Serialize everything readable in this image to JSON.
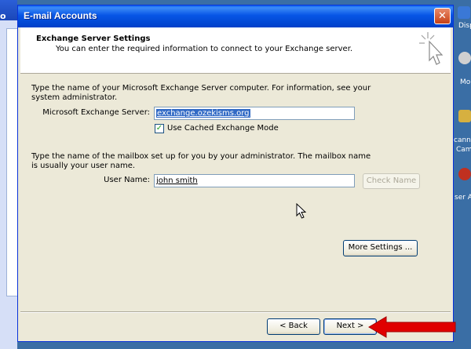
{
  "background": {
    "left_window_label": "o",
    "right_icons": [
      {
        "label": "Disp",
        "icon": "display-icon",
        "color": "#3a78d6"
      },
      {
        "label": "Mo",
        "icon": "mouse-icon",
        "color": "#d0d0d0"
      },
      {
        "label": "canne",
        "icon": "scanner-icon",
        "color": "#d6b040"
      },
      {
        "label": "Cam",
        "icon": "camera-icon",
        "color": "#d6b040"
      },
      {
        "label": "ser A",
        "icon": "user-accounts-icon",
        "color": "#c03020"
      }
    ]
  },
  "dialog": {
    "title": "E-mail Accounts",
    "close_glyph": "✕",
    "header": {
      "title": "Exchange Server Settings",
      "subtitle": "You can enter the required information to connect to your Exchange server."
    },
    "server_section": {
      "instruction_line1": "Type the name of your Microsoft Exchange Server computer. For information, see your",
      "instruction_line2": "system administrator.",
      "server_label": "Microsoft Exchange Server:",
      "server_value": "exchange.ozekisms.org",
      "cached_mode_label": "Use Cached Exchange Mode",
      "cached_mode_checked": true
    },
    "mailbox_section": {
      "instruction_line1": "Type the name of the mailbox set up for you by your administrator. The mailbox name",
      "instruction_line2": "is usually your user name.",
      "user_label": "User Name:",
      "user_value": "john smith",
      "check_name_label": "Check Name"
    },
    "more_settings_label": "More Settings ...",
    "back_label": "< Back",
    "next_label": "Next >"
  },
  "colors": {
    "titlebar": "#0755e6",
    "dialog_bg": "#ece9d8",
    "selection": "#316ac5",
    "arrow": "#e00000"
  }
}
